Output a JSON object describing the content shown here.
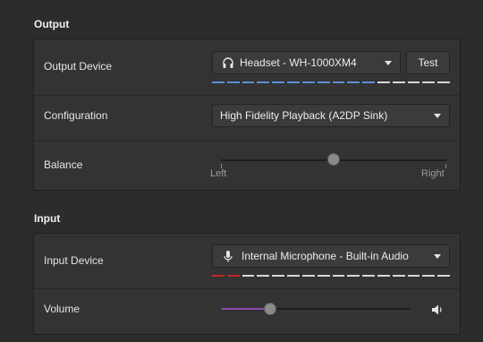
{
  "output": {
    "section_title": "Output",
    "device_label": "Output Device",
    "device_value": "Headset - WH-1000XM4",
    "device_icon": "headphones-icon",
    "test_label": "Test",
    "level_segments_active": 11,
    "level_segments_total": 16,
    "level_active_color": "#5b8fd6",
    "configuration_label": "Configuration",
    "configuration_value": "High Fidelity Playback (A2DP Sink)",
    "balance_label": "Balance",
    "balance_left": "Left",
    "balance_right": "Right",
    "balance_value": 0.5
  },
  "input": {
    "section_title": "Input",
    "device_label": "Input Device",
    "device_value": "Internal Microphone - Built-in Audio",
    "device_icon": "microphone-icon",
    "level_segments_active": 2,
    "level_segments_total": 16,
    "level_active_color": "#c0262d",
    "volume_label": "Volume",
    "volume_value": 0.26,
    "volume_icon": "speaker-icon",
    "volume_fill_color": "#8b4aa8"
  }
}
